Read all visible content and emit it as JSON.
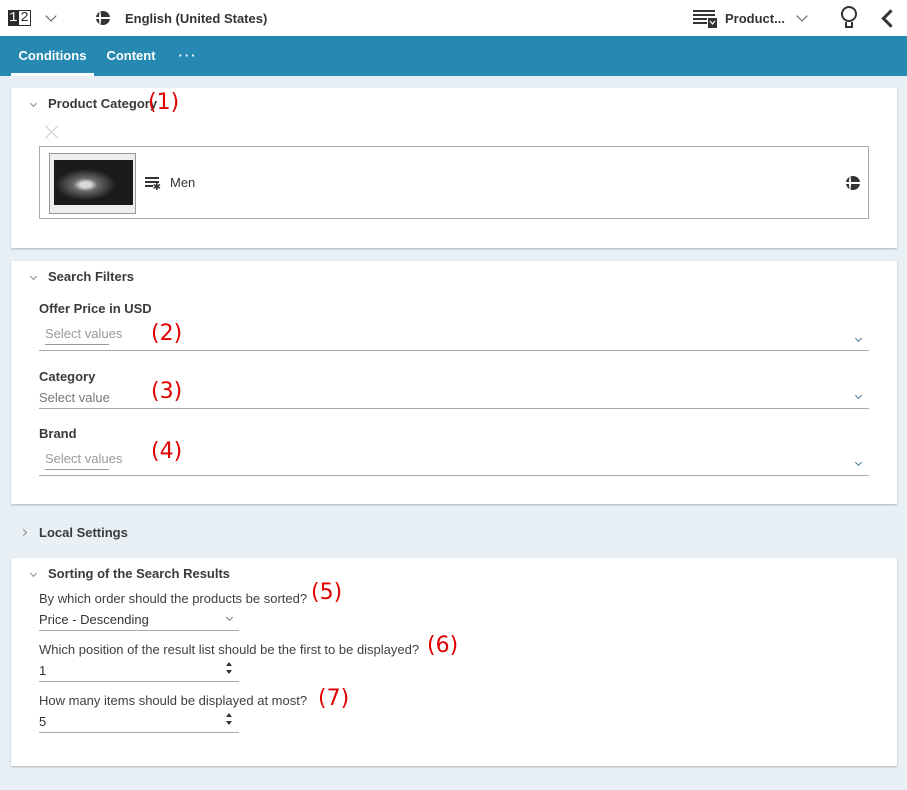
{
  "topbar": {
    "number_icon": {
      "digit1": "1",
      "digit2": "2",
      "icon": "numbering-icon"
    },
    "language": {
      "icon": "globe-icon",
      "label": "English (United States)"
    },
    "product": {
      "icon": "product-list-icon",
      "label": "Product..."
    },
    "tips_icon": "lightbulb-icon",
    "back_icon": "chevron-left-icon"
  },
  "tabs": [
    {
      "label": "Conditions",
      "active": true
    },
    {
      "label": "Content",
      "active": false
    },
    {
      "label": "···",
      "active": false
    }
  ],
  "product_category": {
    "title": "Product Category",
    "annotation": "(1)",
    "item": {
      "label": "Men",
      "type_icon": "category-icon",
      "locale_icon": "globe-icon"
    }
  },
  "search_filters": {
    "title": "Search Filters",
    "fields": [
      {
        "label": "Offer Price in USD",
        "placeholder": "Select values",
        "annotation": "(2)"
      },
      {
        "label": "Category",
        "placeholder": "Select value",
        "annotation": "(3)"
      },
      {
        "label": "Brand",
        "placeholder": "Select values",
        "annotation": "(4)"
      }
    ]
  },
  "local_settings": {
    "title": "Local Settings"
  },
  "sorting": {
    "title": "Sorting of the Search Results",
    "order": {
      "question": "By which order should the products be sorted?",
      "value": "Price - Descending",
      "annotation": "(5)"
    },
    "first_position": {
      "question": "Which position of the result list should be the first to be displayed?",
      "value": "1",
      "annotation": "(6)"
    },
    "max_items": {
      "question": "How many items should be displayed at most?",
      "value": "5",
      "annotation": "(7)"
    }
  },
  "colors": {
    "tab_bar": "#2589b1",
    "annotation": "#e00000",
    "background": "#e8f0f6"
  }
}
